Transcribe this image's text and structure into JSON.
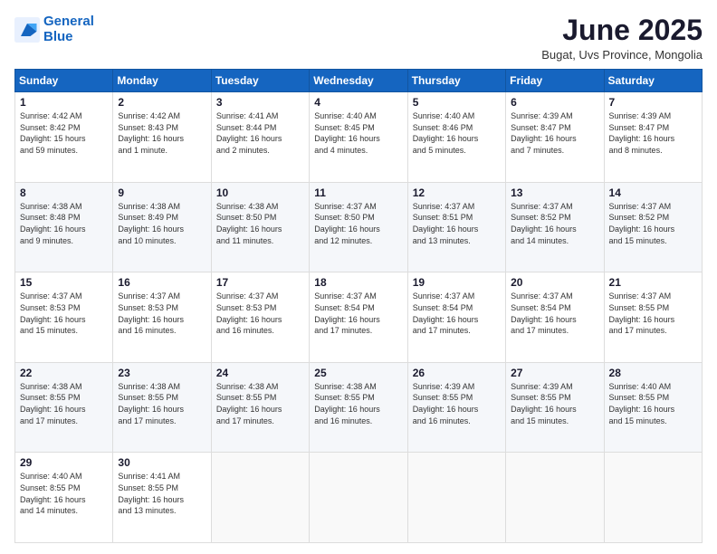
{
  "logo": {
    "line1": "General",
    "line2": "Blue"
  },
  "title": "June 2025",
  "subtitle": "Bugat, Uvs Province, Mongolia",
  "calendar": {
    "headers": [
      "Sunday",
      "Monday",
      "Tuesday",
      "Wednesday",
      "Thursday",
      "Friday",
      "Saturday"
    ],
    "weeks": [
      [
        {
          "day": "1",
          "info": "Sunrise: 4:42 AM\nSunset: 8:42 PM\nDaylight: 15 hours\nand 59 minutes."
        },
        {
          "day": "2",
          "info": "Sunrise: 4:42 AM\nSunset: 8:43 PM\nDaylight: 16 hours\nand 1 minute."
        },
        {
          "day": "3",
          "info": "Sunrise: 4:41 AM\nSunset: 8:44 PM\nDaylight: 16 hours\nand 2 minutes."
        },
        {
          "day": "4",
          "info": "Sunrise: 4:40 AM\nSunset: 8:45 PM\nDaylight: 16 hours\nand 4 minutes."
        },
        {
          "day": "5",
          "info": "Sunrise: 4:40 AM\nSunset: 8:46 PM\nDaylight: 16 hours\nand 5 minutes."
        },
        {
          "day": "6",
          "info": "Sunrise: 4:39 AM\nSunset: 8:47 PM\nDaylight: 16 hours\nand 7 minutes."
        },
        {
          "day": "7",
          "info": "Sunrise: 4:39 AM\nSunset: 8:47 PM\nDaylight: 16 hours\nand 8 minutes."
        }
      ],
      [
        {
          "day": "8",
          "info": "Sunrise: 4:38 AM\nSunset: 8:48 PM\nDaylight: 16 hours\nand 9 minutes."
        },
        {
          "day": "9",
          "info": "Sunrise: 4:38 AM\nSunset: 8:49 PM\nDaylight: 16 hours\nand 10 minutes."
        },
        {
          "day": "10",
          "info": "Sunrise: 4:38 AM\nSunset: 8:50 PM\nDaylight: 16 hours\nand 11 minutes."
        },
        {
          "day": "11",
          "info": "Sunrise: 4:37 AM\nSunset: 8:50 PM\nDaylight: 16 hours\nand 12 minutes."
        },
        {
          "day": "12",
          "info": "Sunrise: 4:37 AM\nSunset: 8:51 PM\nDaylight: 16 hours\nand 13 minutes."
        },
        {
          "day": "13",
          "info": "Sunrise: 4:37 AM\nSunset: 8:52 PM\nDaylight: 16 hours\nand 14 minutes."
        },
        {
          "day": "14",
          "info": "Sunrise: 4:37 AM\nSunset: 8:52 PM\nDaylight: 16 hours\nand 15 minutes."
        }
      ],
      [
        {
          "day": "15",
          "info": "Sunrise: 4:37 AM\nSunset: 8:53 PM\nDaylight: 16 hours\nand 15 minutes."
        },
        {
          "day": "16",
          "info": "Sunrise: 4:37 AM\nSunset: 8:53 PM\nDaylight: 16 hours\nand 16 minutes."
        },
        {
          "day": "17",
          "info": "Sunrise: 4:37 AM\nSunset: 8:53 PM\nDaylight: 16 hours\nand 16 minutes."
        },
        {
          "day": "18",
          "info": "Sunrise: 4:37 AM\nSunset: 8:54 PM\nDaylight: 16 hours\nand 17 minutes."
        },
        {
          "day": "19",
          "info": "Sunrise: 4:37 AM\nSunset: 8:54 PM\nDaylight: 16 hours\nand 17 minutes."
        },
        {
          "day": "20",
          "info": "Sunrise: 4:37 AM\nSunset: 8:54 PM\nDaylight: 16 hours\nand 17 minutes."
        },
        {
          "day": "21",
          "info": "Sunrise: 4:37 AM\nSunset: 8:55 PM\nDaylight: 16 hours\nand 17 minutes."
        }
      ],
      [
        {
          "day": "22",
          "info": "Sunrise: 4:38 AM\nSunset: 8:55 PM\nDaylight: 16 hours\nand 17 minutes."
        },
        {
          "day": "23",
          "info": "Sunrise: 4:38 AM\nSunset: 8:55 PM\nDaylight: 16 hours\nand 17 minutes."
        },
        {
          "day": "24",
          "info": "Sunrise: 4:38 AM\nSunset: 8:55 PM\nDaylight: 16 hours\nand 17 minutes."
        },
        {
          "day": "25",
          "info": "Sunrise: 4:38 AM\nSunset: 8:55 PM\nDaylight: 16 hours\nand 16 minutes."
        },
        {
          "day": "26",
          "info": "Sunrise: 4:39 AM\nSunset: 8:55 PM\nDaylight: 16 hours\nand 16 minutes."
        },
        {
          "day": "27",
          "info": "Sunrise: 4:39 AM\nSunset: 8:55 PM\nDaylight: 16 hours\nand 15 minutes."
        },
        {
          "day": "28",
          "info": "Sunrise: 4:40 AM\nSunset: 8:55 PM\nDaylight: 16 hours\nand 15 minutes."
        }
      ],
      [
        {
          "day": "29",
          "info": "Sunrise: 4:40 AM\nSunset: 8:55 PM\nDaylight: 16 hours\nand 14 minutes."
        },
        {
          "day": "30",
          "info": "Sunrise: 4:41 AM\nSunset: 8:55 PM\nDaylight: 16 hours\nand 13 minutes."
        },
        {
          "day": "",
          "info": ""
        },
        {
          "day": "",
          "info": ""
        },
        {
          "day": "",
          "info": ""
        },
        {
          "day": "",
          "info": ""
        },
        {
          "day": "",
          "info": ""
        }
      ]
    ]
  }
}
